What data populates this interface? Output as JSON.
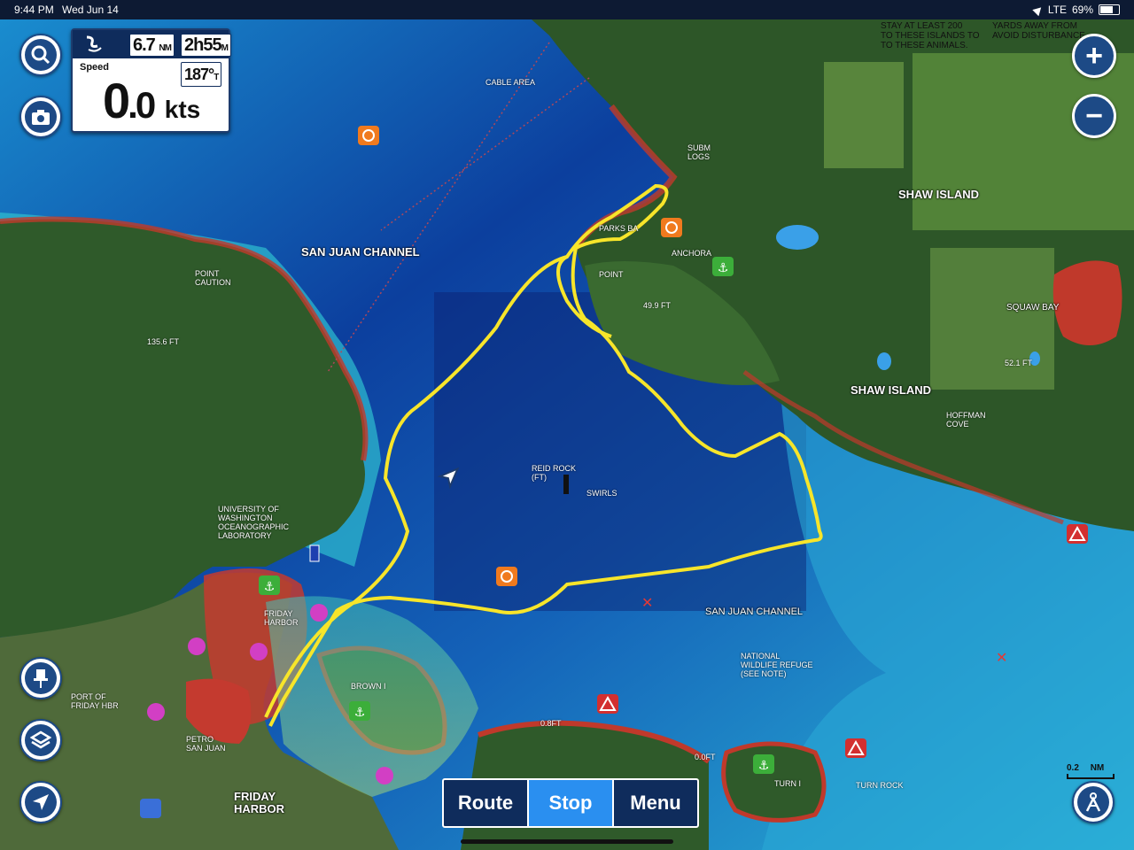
{
  "status_bar": {
    "time": "9:44 PM",
    "date": "Wed Jun 14",
    "network": "LTE",
    "battery": "69%",
    "battery_level": 0.69
  },
  "nav_panel": {
    "distance_value": "6.7",
    "distance_unit": "NM",
    "time_value": "2h55",
    "time_unit": "M",
    "heading_value": "187°",
    "heading_unit": "T",
    "speed_label": "Speed",
    "speed_whole": "0",
    "speed_decimal": ".0",
    "speed_unit": "kts"
  },
  "left_controls": [
    "search-icon",
    "camera-icon",
    "pin-icon",
    "layers-icon",
    "location-arrow-icon"
  ],
  "right_controls": [
    "zoom-in-icon",
    "zoom-out-icon",
    "track-mode-icon"
  ],
  "bottom_bar": {
    "route": "Route",
    "stop": "Stop",
    "menu": "Menu"
  },
  "scale": {
    "value": "0.2",
    "unit": "NM"
  },
  "map_labels": {
    "san_juan_channel_north": "SAN JUAN CHANNEL",
    "san_juan_channel_south": "SAN JUAN CHANNEL",
    "shaw_island_1": "SHAW ISLAND",
    "shaw_island_2": "SHAW ISLAND",
    "squaw_bay": "SQUAW BAY",
    "hoffman_cove_1": "HOFFMAN",
    "hoffman_cove_2": "COVE",
    "friday_harbor_1": "FRIDAY",
    "friday_harbor_2": "HARBOR",
    "friday_harbor_town_1": "FRIDAY",
    "friday_harbor_town_2": "HARBOR",
    "port_friday_1": "PORT OF",
    "port_friday_2": "FRIDAY HBR",
    "petro_1": "PETRO",
    "petro_2": "SAN JUAN",
    "univ_1": "UNIVERSITY OF",
    "univ_2": "WASHINGTON",
    "univ_3": "OCEANOGRAPHIC",
    "univ_4": "LABORATORY",
    "point_caution_1": "POINT",
    "point_caution_2": "CAUTION",
    "parks_bay": "PARKS BA",
    "anchorage": "ANCHORA",
    "point": "POINT",
    "reid_rock_1": "REID ROCK",
    "reid_rock_2": "(FT)",
    "swirls": "SWIRLS",
    "refuge_1": "NATIONAL",
    "refuge_2": "WILDLIFE REFUGE",
    "refuge_3": "(SEE NOTE)",
    "cable_area": "CABLE AREA",
    "subm_logs_1": "SUBM",
    "subm_logs_2": "LOGS",
    "brown_island": "BROWN I",
    "turn_island": "TURN I",
    "turn_rock": "TURN ROCK",
    "depth_135": "135.6 FT",
    "depth_49": "49.9 FT",
    "depth_52": "52.1 FT",
    "depth_08": "0.8FT",
    "depth_00": "0.0FT",
    "stay_1": "STAY AT LEAST 200",
    "stay_2": "TO THESE ISLANDS TO",
    "stay_3": "TO THESE ANIMALS.",
    "yards_1": "YARDS AWAY FROM",
    "yards_2": "AVOID DISTURBANCE"
  },
  "colors": {
    "track": "#f7e52a",
    "panel_navy": "#0f2c5c",
    "button_blue": "#1d4a86",
    "active_blue": "#2a8ff0"
  }
}
